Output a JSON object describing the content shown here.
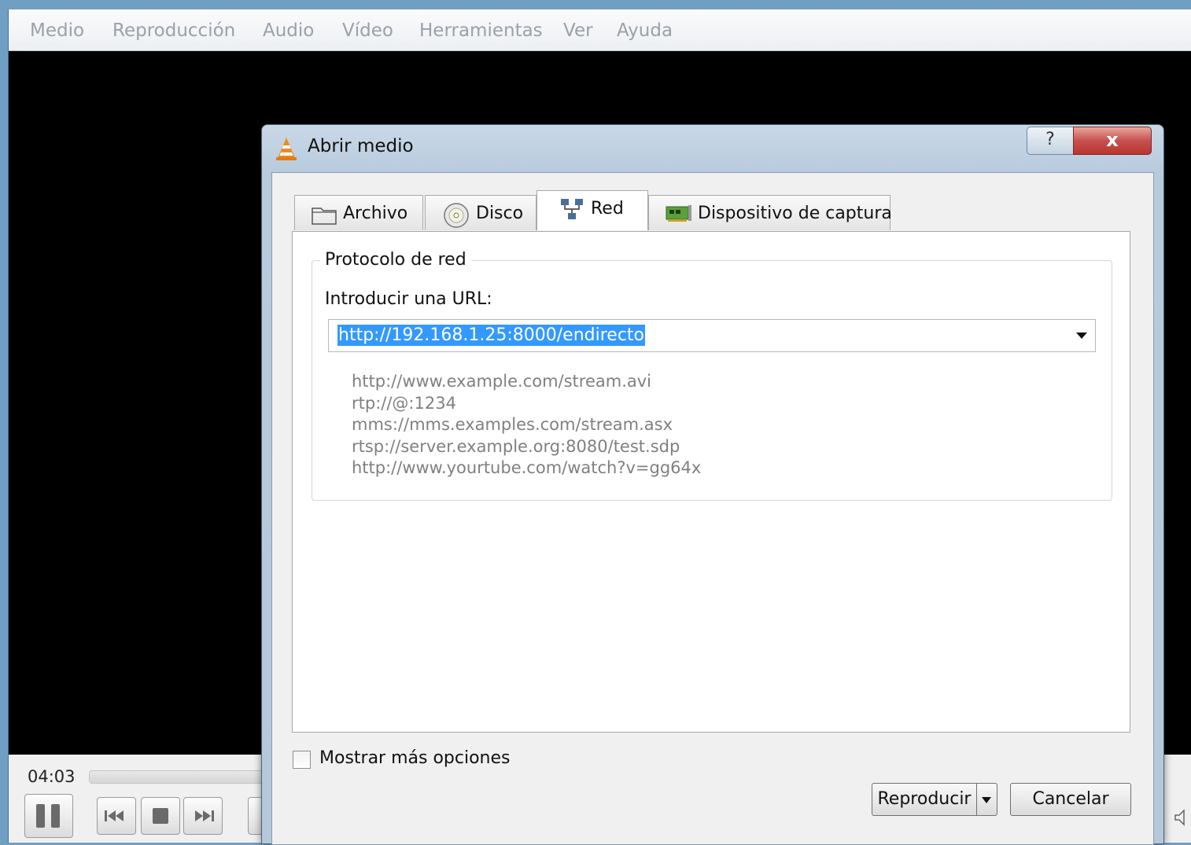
{
  "menubar": {
    "items": [
      "Medio",
      "Reproducción",
      "Audio",
      "Vídeo",
      "Herramientas",
      "Ver",
      "Ayuda"
    ]
  },
  "player": {
    "time": "04:03"
  },
  "dialog": {
    "title": "Abrir medio",
    "help_label": "?",
    "close_label": "x",
    "tabs": [
      {
        "label": "Archivo",
        "icon": "folder-icon"
      },
      {
        "label": "Disco",
        "icon": "disc-icon"
      },
      {
        "label": "Red",
        "icon": "network-icon",
        "active": true
      },
      {
        "label": "Dispositivo de captura",
        "icon": "capture-card-icon"
      }
    ],
    "network": {
      "group_title": "Protocolo de red",
      "url_label": "Introducir una URL:",
      "url_value": "http://192.168.1.25:8000/endirecto",
      "examples": [
        "http://www.example.com/stream.avi",
        "rtp://@:1234",
        "mms://mms.examples.com/stream.asx",
        "rtsp://server.example.org:8080/test.sdp",
        "http://www.yourtube.com/watch?v=gg64x"
      ]
    },
    "more_options_label": "Mostrar más opciones",
    "more_options_checked": false,
    "play_label": "Reproducir",
    "cancel_label": "Cancelar"
  }
}
